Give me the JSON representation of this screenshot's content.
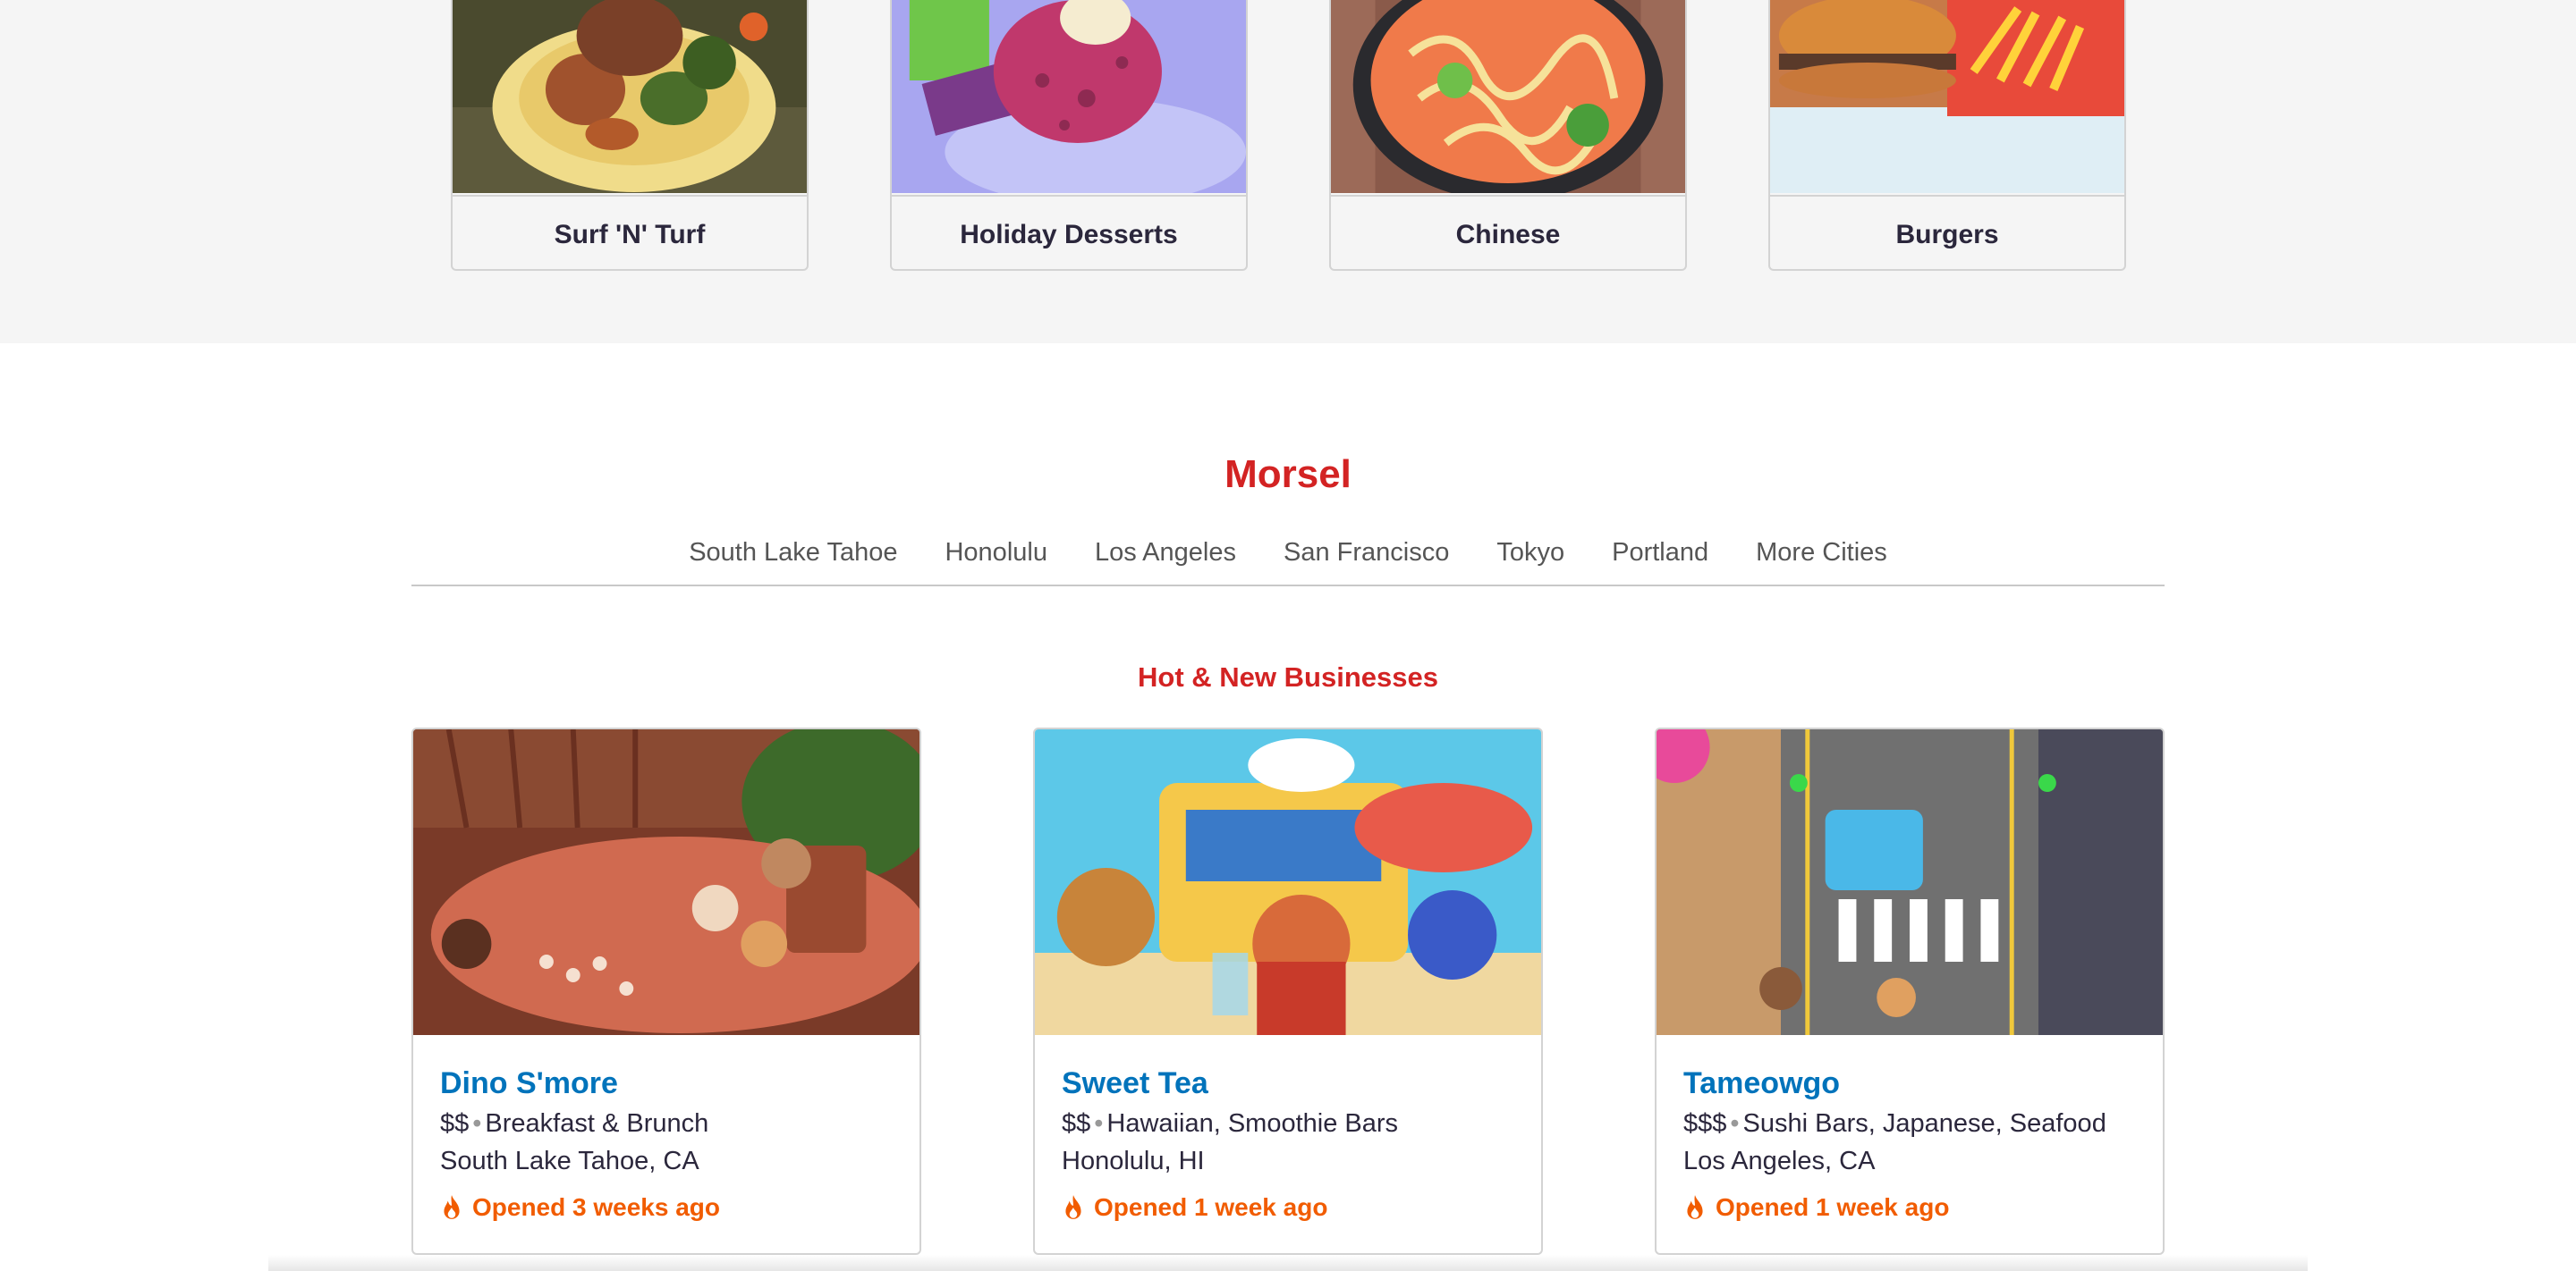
{
  "categories": [
    {
      "label": "Surf 'N' Turf",
      "icon": "food-plate-image"
    },
    {
      "label": "Holiday Desserts",
      "icon": "dessert-image"
    },
    {
      "label": "Chinese",
      "icon": "noodle-pot-image"
    },
    {
      "label": "Burgers",
      "icon": "burger-fries-image"
    }
  ],
  "brand": "Morsel",
  "cities": [
    "South Lake Tahoe",
    "Honolulu",
    "Los Angeles",
    "San Francisco",
    "Tokyo",
    "Portland",
    "More Cities"
  ],
  "hot_new": {
    "title": "Hot & New Businesses",
    "businesses": [
      {
        "name": "Dino S'more",
        "price": "$$",
        "dot": "•",
        "categories": "Breakfast & Brunch",
        "location": "South Lake Tahoe, CA",
        "opened": "Opened 3 weeks ago"
      },
      {
        "name": "Sweet Tea",
        "price": "$$",
        "dot": "•",
        "categories": "Hawaiian, Smoothie Bars",
        "location": "Honolulu, HI",
        "opened": "Opened 1 week ago"
      },
      {
        "name": "Tameowgo",
        "price": "$$$",
        "dot": "•",
        "categories": "Sushi Bars, Japanese, Seafood",
        "location": "Los Angeles, CA",
        "opened": "Opened 1 week ago"
      }
    ]
  },
  "colors": {
    "brand_red": "#d32323",
    "link_blue": "#0073bb",
    "hot_orange": "#f15c00",
    "bg_gray": "#f5f5f5"
  }
}
